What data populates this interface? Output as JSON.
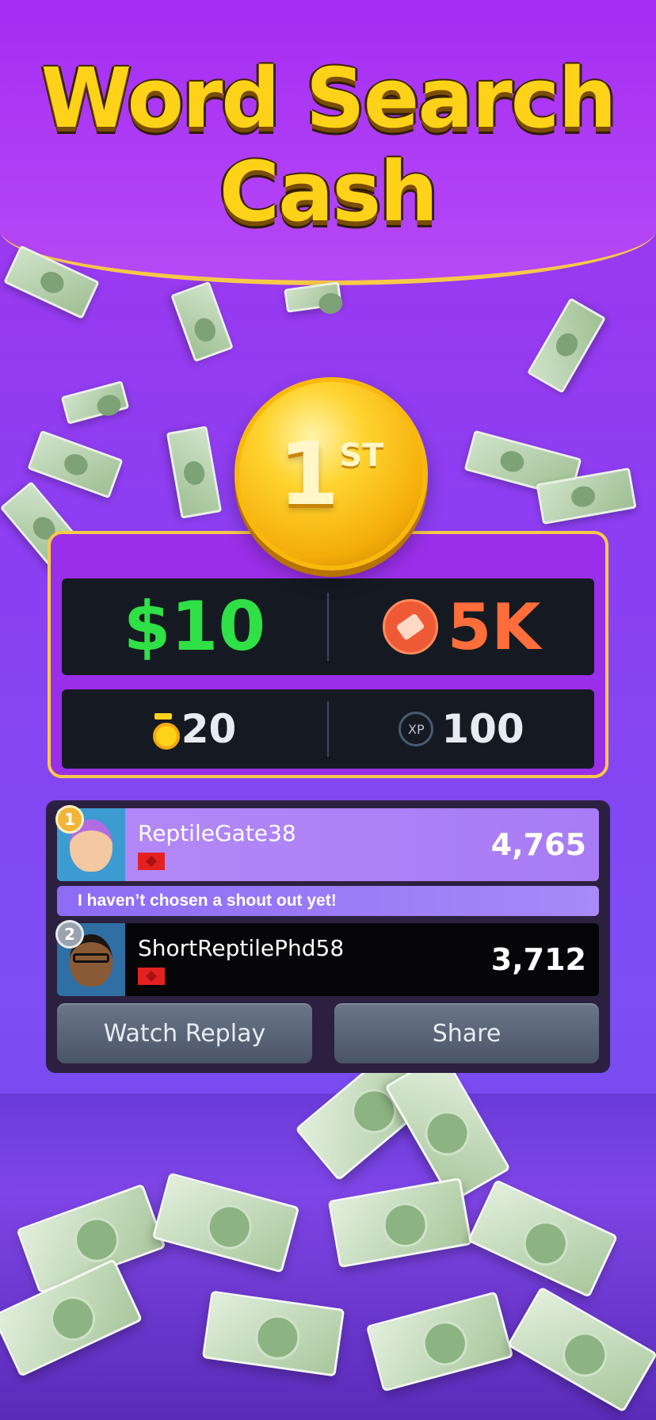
{
  "header": {
    "title_line1": "Word Search",
    "title_line2": "Cash"
  },
  "placement": {
    "rank_number": "1",
    "rank_suffix": "ST"
  },
  "rewards": {
    "cash": "$10",
    "tickets": "5K",
    "medals": "20",
    "xp_label": "XP",
    "xp": "100"
  },
  "leaderboard": {
    "players": [
      {
        "rank": "1",
        "name": "ReptileGate38",
        "score": "4,765"
      },
      {
        "rank": "2",
        "name": "ShortReptilePhd58",
        "score": "3,712"
      }
    ],
    "shout_out": "I haven’t chosen a shout out yet!"
  },
  "actions": {
    "watch_replay": "Watch Replay",
    "share": "Share"
  },
  "colors": {
    "background": "#9a38f0",
    "title": "#ffd21a",
    "cash": "#2fe046",
    "tickets": "#ff6e3a"
  }
}
